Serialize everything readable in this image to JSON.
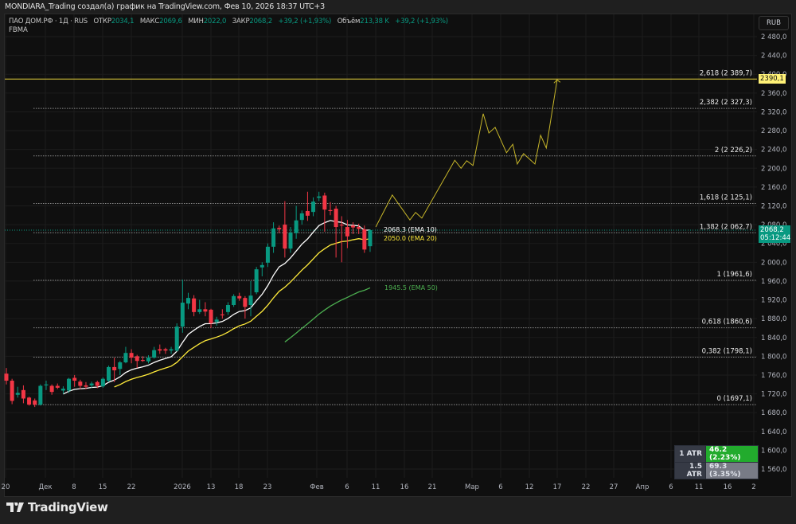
{
  "header": {
    "title": "MONDIARA_Trading создал(а) график на TradingView.com, Фев 10, 2026 18:37 UTC+3"
  },
  "legend": {
    "symbol": "ПАО ДОМ.РФ · 1Д · RUS",
    "open_label": "ОТКР",
    "open": "2034,1",
    "high_label": "МАКС",
    "high": "2069,6",
    "low_label": "МИН",
    "low": "2022,0",
    "close_label": "ЗАКР",
    "close": "2068,2",
    "change": "+39,2 (+1,93%)",
    "volume_label": "Объём",
    "volume": "213,38 K",
    "change2": "+39,2 (+1,93%)",
    "indicator": "FBMA"
  },
  "currency_button": "RUB",
  "price_tag": {
    "price": "2068,2",
    "countdown": "05:12:44"
  },
  "target_tag": "2390,1",
  "ema_labels": [
    {
      "text": "2068.3 (EMA 10)",
      "value": 2068.3,
      "color": "#ffffff"
    },
    {
      "text": "2050.0 (EMA 20)",
      "value": 2050.0,
      "color": "#ffeb3b"
    },
    {
      "text": "1945.5 (EMA 50)",
      "value": 1945.5,
      "color": "#4caf50"
    }
  ],
  "atr_table": [
    {
      "label": "1 ATR",
      "value": "46.2 (2.23%)"
    },
    {
      "label": "1.5 ATR",
      "value": "69.3 (3.35%)"
    }
  ],
  "logo_text": "TradingView",
  "colors": {
    "up": "#089981",
    "down": "#f23645",
    "projection": "#c8b72a",
    "target": "#e6d23c"
  },
  "chart_data": {
    "type": "candlestick",
    "y_axis": {
      "min": 1540,
      "max": 2500,
      "ticks": [
        "2 480,0",
        "2 440,0",
        "2 400,0",
        "2 360,0",
        "2 320,0",
        "2 280,0",
        "2 240,0",
        "2 200,0",
        "2 160,0",
        "2 120,0",
        "2 080,0",
        "2 040,0",
        "2 000,0",
        "1 960,0",
        "1 920,0",
        "1 880,0",
        "1 840,0",
        "1 800,0",
        "1 760,0",
        "1 720,0",
        "1 680,0",
        "1 640,0",
        "1 600,0",
        "1 560,0"
      ]
    },
    "x_axis": {
      "ticks": [
        "20",
        "Дек",
        "8",
        "15",
        "22",
        "2026",
        "13",
        "18",
        "23",
        "Фев",
        "6",
        "11",
        "16",
        "21",
        "Мар",
        "6",
        "12",
        "17",
        "22",
        "27",
        "Апр",
        "6",
        "11",
        "16",
        "2"
      ]
    },
    "candles": [
      [
        1763,
        1775,
        1740,
        1748
      ],
      [
        1748,
        1752,
        1698,
        1705
      ],
      [
        1718,
        1735,
        1712,
        1722
      ],
      [
        1728,
        1738,
        1700,
        1710
      ],
      [
        1712,
        1714,
        1695,
        1697
      ],
      [
        1706,
        1710,
        1692,
        1697
      ],
      [
        1697,
        1740,
        1695,
        1737
      ],
      [
        1738,
        1748,
        1728,
        1740
      ],
      [
        1737,
        1740,
        1718,
        1724
      ],
      [
        1737,
        1742,
        1730,
        1733
      ],
      [
        1727,
        1736,
        1720,
        1731
      ],
      [
        1727,
        1754,
        1722,
        1752
      ],
      [
        1754,
        1760,
        1735,
        1748
      ],
      [
        1746,
        1750,
        1730,
        1737
      ],
      [
        1738,
        1745,
        1730,
        1735
      ],
      [
        1738,
        1746,
        1733,
        1742
      ],
      [
        1745,
        1748,
        1732,
        1737
      ],
      [
        1736,
        1755,
        1733,
        1752
      ],
      [
        1748,
        1780,
        1745,
        1777
      ],
      [
        1777,
        1797,
        1745,
        1770
      ],
      [
        1773,
        1790,
        1760,
        1787
      ],
      [
        1787,
        1820,
        1785,
        1807
      ],
      [
        1807,
        1815,
        1785,
        1797
      ],
      [
        1800,
        1803,
        1775,
        1790
      ],
      [
        1792,
        1800,
        1788,
        1790
      ],
      [
        1789,
        1802,
        1785,
        1797
      ],
      [
        1797,
        1820,
        1795,
        1813
      ],
      [
        1815,
        1825,
        1805,
        1812
      ],
      [
        1815,
        1818,
        1805,
        1812
      ],
      [
        1812,
        1820,
        1805,
        1815
      ],
      [
        1812,
        1870,
        1810,
        1863
      ],
      [
        1863,
        1963,
        1850,
        1914
      ],
      [
        1912,
        1935,
        1900,
        1924
      ],
      [
        1923,
        1930,
        1885,
        1894
      ],
      [
        1894,
        1920,
        1890,
        1900
      ],
      [
        1900,
        1915,
        1885,
        1895
      ],
      [
        1899,
        1901,
        1860,
        1870
      ],
      [
        1873,
        1884,
        1865,
        1878
      ],
      [
        1889,
        1900,
        1880,
        1887
      ],
      [
        1894,
        1915,
        1888,
        1909
      ],
      [
        1909,
        1932,
        1905,
        1928
      ],
      [
        1928,
        1935,
        1918,
        1923
      ],
      [
        1924,
        1928,
        1880,
        1905
      ],
      [
        1909,
        1960,
        1885,
        1929
      ],
      [
        1936,
        1990,
        1932,
        1985
      ],
      [
        1989,
        2000,
        1970,
        1994
      ],
      [
        1999,
        2040,
        1990,
        2033
      ],
      [
        2033,
        2085,
        2020,
        2072
      ],
      [
        2073,
        2078,
        2062,
        2070
      ],
      [
        2080,
        2130,
        2010,
        2029
      ],
      [
        2029,
        2075,
        2020,
        2063
      ],
      [
        2062,
        2120,
        2050,
        2089
      ],
      [
        2090,
        2110,
        2080,
        2104
      ],
      [
        2109,
        2150,
        2088,
        2099
      ],
      [
        2107,
        2138,
        2098,
        2129
      ],
      [
        2137,
        2150,
        2130,
        2140
      ],
      [
        2142,
        2148,
        2065,
        2112
      ],
      [
        2111,
        2128,
        2100,
        2109
      ],
      [
        2114,
        2120,
        2010,
        2075
      ],
      [
        2080,
        2098,
        2000,
        2078
      ],
      [
        2075,
        2090,
        2030,
        2055
      ],
      [
        2078,
        2085,
        2060,
        2074
      ],
      [
        2075,
        2082,
        2060,
        2071
      ],
      [
        2070,
        2078,
        2020,
        2027
      ],
      [
        2034.1,
        2069.6,
        2022.0,
        2068.2
      ]
    ],
    "fib_levels": [
      {
        "label": "2,618 (2 389,7)",
        "price": 2389.7,
        "solid": true
      },
      {
        "label": "2,382 (2 327,3)",
        "price": 2327.3
      },
      {
        "label": "2 (2 226,2)",
        "price": 2226.2
      },
      {
        "label": "1,618 (2 125,1)",
        "price": 2125.1
      },
      {
        "label": "1,382 (2 062,7)",
        "price": 2062.7
      },
      {
        "label": "1 (1961,6)",
        "price": 1961.6
      },
      {
        "label": "0,618 (1860,6)",
        "price": 1860.6
      },
      {
        "label": "0,382 (1798,1)",
        "price": 1798.1
      },
      {
        "label": "0 (1697,1)",
        "price": 1697.1
      }
    ],
    "projection": [
      [
        65.0,
        2075
      ],
      [
        67.9,
        2143
      ],
      [
        71.0,
        2090
      ],
      [
        72.0,
        2106
      ],
      [
        73.1,
        2094
      ],
      [
        78.9,
        2217
      ],
      [
        80.0,
        2200
      ],
      [
        81.0,
        2216
      ],
      [
        82.1,
        2206
      ],
      [
        83.9,
        2316
      ],
      [
        84.9,
        2275
      ],
      [
        86.0,
        2287
      ],
      [
        88.0,
        2233
      ],
      [
        89.1,
        2251
      ],
      [
        89.9,
        2209
      ],
      [
        91.0,
        2231
      ],
      [
        93.0,
        2209
      ],
      [
        94.0,
        2270
      ],
      [
        95.0,
        2243
      ],
      [
        96.9,
        2388
      ]
    ]
  }
}
